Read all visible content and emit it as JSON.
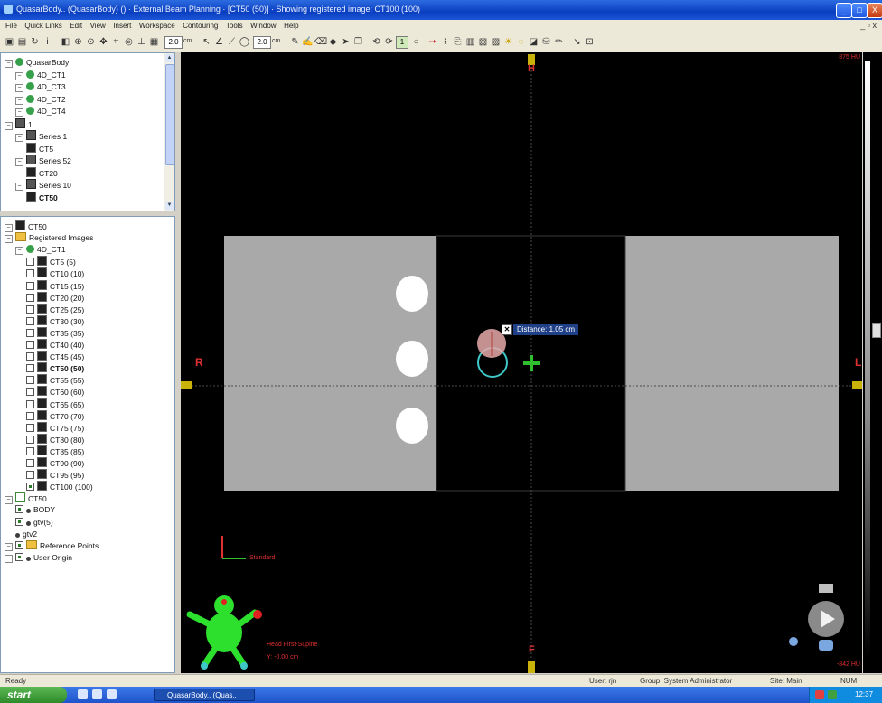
{
  "window": {
    "title": "QuasarBody.. (QuasarBody) () · External Beam Planning · [CT50 (50)] · Showing registered image: CT100 (100)",
    "buttons": {
      "minimize": "_",
      "maximize": "□",
      "close": "X"
    }
  },
  "menu": {
    "items": [
      "File",
      "Quick Links",
      "Edit",
      "View",
      "Insert",
      "Workspace",
      "Contouring",
      "Tools",
      "Window",
      "Help"
    ],
    "mdi_controls": "_ ▫ x"
  },
  "toolbar": {
    "width_value": "2.0",
    "width_unit": "cm",
    "size_value": "2.0",
    "size_unit": "cm",
    "page_value": "1"
  },
  "tree_top": {
    "nodes": [
      {
        "label": "QuasarBody",
        "indent": 0,
        "icon": "patient"
      },
      {
        "label": "4D_CT1",
        "indent": 1,
        "icon": "green"
      },
      {
        "label": "4D_CT3",
        "indent": 1,
        "icon": "green"
      },
      {
        "label": "4D_CT2",
        "indent": 1,
        "icon": "green"
      },
      {
        "label": "4D_CT4",
        "indent": 1,
        "icon": "green"
      },
      {
        "label": "1",
        "indent": 0,
        "icon": "group"
      },
      {
        "label": "Series 1",
        "indent": 1,
        "icon": "stack"
      },
      {
        "label": "CT5",
        "indent": 2,
        "icon": "ct"
      },
      {
        "label": "Series 52",
        "indent": 1,
        "icon": "stack"
      },
      {
        "label": "CT20",
        "indent": 2,
        "icon": "ct"
      },
      {
        "label": "Series 10",
        "indent": 1,
        "icon": "stack"
      },
      {
        "label": "CT50",
        "indent": 2,
        "icon": "ct",
        "bold": true
      }
    ]
  },
  "tree_bottom": {
    "nodes": [
      {
        "label": "CT50",
        "indent": 0,
        "icon": "ct"
      },
      {
        "label": "Registered Images",
        "indent": 0,
        "icon": "folder"
      },
      {
        "label": "4D_CT1",
        "indent": 1,
        "icon": "green"
      },
      {
        "label": "CT5 (5)",
        "indent": 2,
        "icon": "ct"
      },
      {
        "label": "CT10 (10)",
        "indent": 2,
        "icon": "ct"
      },
      {
        "label": "CT15 (15)",
        "indent": 2,
        "icon": "ct"
      },
      {
        "label": "CT20 (20)",
        "indent": 2,
        "icon": "ct"
      },
      {
        "label": "CT25 (25)",
        "indent": 2,
        "icon": "ct"
      },
      {
        "label": "CT30 (30)",
        "indent": 2,
        "icon": "ct"
      },
      {
        "label": "CT35 (35)",
        "indent": 2,
        "icon": "ct"
      },
      {
        "label": "CT40 (40)",
        "indent": 2,
        "icon": "ct"
      },
      {
        "label": "CT45 (45)",
        "indent": 2,
        "icon": "ct"
      },
      {
        "label": "CT50 (50)",
        "indent": 2,
        "icon": "ct",
        "bold": true
      },
      {
        "label": "CT55 (55)",
        "indent": 2,
        "icon": "ct"
      },
      {
        "label": "CT60 (60)",
        "indent": 2,
        "icon": "ct"
      },
      {
        "label": "CT65 (65)",
        "indent": 2,
        "icon": "ct"
      },
      {
        "label": "CT70 (70)",
        "indent": 2,
        "icon": "ct"
      },
      {
        "label": "CT75 (75)",
        "indent": 2,
        "icon": "ct"
      },
      {
        "label": "CT80 (80)",
        "indent": 2,
        "icon": "ct"
      },
      {
        "label": "CT85 (85)",
        "indent": 2,
        "icon": "ct"
      },
      {
        "label": "CT90 (90)",
        "indent": 2,
        "icon": "ct"
      },
      {
        "label": "CT95 (95)",
        "indent": 2,
        "icon": "ct"
      },
      {
        "label": "CT100 (100)",
        "indent": 2,
        "icon": "ct",
        "checked": true
      },
      {
        "label": "CT50",
        "indent": 0,
        "icon": "contour"
      },
      {
        "label": "BODY",
        "indent": 1,
        "icon": "pt",
        "checked": true
      },
      {
        "label": "gtv(5)",
        "indent": 1,
        "icon": "pt",
        "checked": true
      },
      {
        "label": "gtv2",
        "indent": 1,
        "icon": "pt"
      },
      {
        "label": "Reference Points",
        "indent": 0,
        "icon": "folder",
        "checked": true
      },
      {
        "label": "User Origin",
        "indent": 0,
        "icon": "origin",
        "checked": true
      }
    ]
  },
  "viewer": {
    "orientation": {
      "top": "H",
      "bottom": "F",
      "left": "R",
      "right": "L"
    },
    "measurement_label": "Distance: 1.05 cm",
    "scale_label": "Standard",
    "orientation_text": "Head First-Supine",
    "position_text": "Y: -0.00 cm",
    "corner_tr": "875 HU",
    "corner_br": "-842 HU",
    "colors": {
      "phantom": "#a9a9a9",
      "crosshair": "#2fbf2f",
      "orient": "#e03030",
      "marker": "#c9b20a"
    }
  },
  "status": {
    "ready": "Ready",
    "user": "User: rjn",
    "group": "Group: System Administrator",
    "site": "Site: Main",
    "num": "NUM"
  },
  "taskbar": {
    "start_label": "start",
    "task_label": "QuasarBody.. (Quas..",
    "clock": "12:37"
  }
}
